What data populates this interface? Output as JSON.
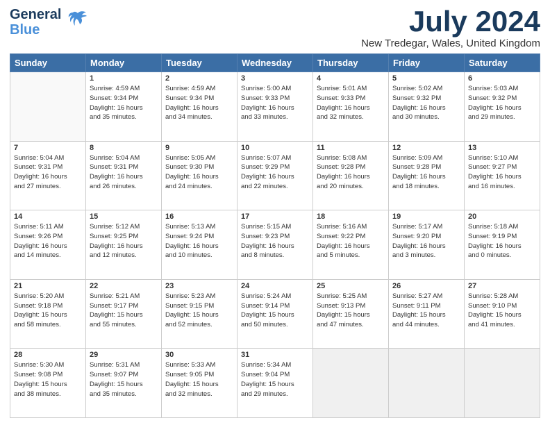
{
  "header": {
    "logo_line1": "General",
    "logo_line2": "Blue",
    "month_title": "July 2024",
    "subtitle": "New Tredegar, Wales, United Kingdom"
  },
  "days_of_week": [
    "Sunday",
    "Monday",
    "Tuesday",
    "Wednesday",
    "Thursday",
    "Friday",
    "Saturday"
  ],
  "weeks": [
    [
      {
        "day": "",
        "info": ""
      },
      {
        "day": "1",
        "info": "Sunrise: 4:59 AM\nSunset: 9:34 PM\nDaylight: 16 hours\nand 35 minutes."
      },
      {
        "day": "2",
        "info": "Sunrise: 4:59 AM\nSunset: 9:34 PM\nDaylight: 16 hours\nand 34 minutes."
      },
      {
        "day": "3",
        "info": "Sunrise: 5:00 AM\nSunset: 9:33 PM\nDaylight: 16 hours\nand 33 minutes."
      },
      {
        "day": "4",
        "info": "Sunrise: 5:01 AM\nSunset: 9:33 PM\nDaylight: 16 hours\nand 32 minutes."
      },
      {
        "day": "5",
        "info": "Sunrise: 5:02 AM\nSunset: 9:32 PM\nDaylight: 16 hours\nand 30 minutes."
      },
      {
        "day": "6",
        "info": "Sunrise: 5:03 AM\nSunset: 9:32 PM\nDaylight: 16 hours\nand 29 minutes."
      }
    ],
    [
      {
        "day": "7",
        "info": "Sunrise: 5:04 AM\nSunset: 9:31 PM\nDaylight: 16 hours\nand 27 minutes."
      },
      {
        "day": "8",
        "info": "Sunrise: 5:04 AM\nSunset: 9:31 PM\nDaylight: 16 hours\nand 26 minutes."
      },
      {
        "day": "9",
        "info": "Sunrise: 5:05 AM\nSunset: 9:30 PM\nDaylight: 16 hours\nand 24 minutes."
      },
      {
        "day": "10",
        "info": "Sunrise: 5:07 AM\nSunset: 9:29 PM\nDaylight: 16 hours\nand 22 minutes."
      },
      {
        "day": "11",
        "info": "Sunrise: 5:08 AM\nSunset: 9:28 PM\nDaylight: 16 hours\nand 20 minutes."
      },
      {
        "day": "12",
        "info": "Sunrise: 5:09 AM\nSunset: 9:28 PM\nDaylight: 16 hours\nand 18 minutes."
      },
      {
        "day": "13",
        "info": "Sunrise: 5:10 AM\nSunset: 9:27 PM\nDaylight: 16 hours\nand 16 minutes."
      }
    ],
    [
      {
        "day": "14",
        "info": "Sunrise: 5:11 AM\nSunset: 9:26 PM\nDaylight: 16 hours\nand 14 minutes."
      },
      {
        "day": "15",
        "info": "Sunrise: 5:12 AM\nSunset: 9:25 PM\nDaylight: 16 hours\nand 12 minutes."
      },
      {
        "day": "16",
        "info": "Sunrise: 5:13 AM\nSunset: 9:24 PM\nDaylight: 16 hours\nand 10 minutes."
      },
      {
        "day": "17",
        "info": "Sunrise: 5:15 AM\nSunset: 9:23 PM\nDaylight: 16 hours\nand 8 minutes."
      },
      {
        "day": "18",
        "info": "Sunrise: 5:16 AM\nSunset: 9:22 PM\nDaylight: 16 hours\nand 5 minutes."
      },
      {
        "day": "19",
        "info": "Sunrise: 5:17 AM\nSunset: 9:20 PM\nDaylight: 16 hours\nand 3 minutes."
      },
      {
        "day": "20",
        "info": "Sunrise: 5:18 AM\nSunset: 9:19 PM\nDaylight: 16 hours\nand 0 minutes."
      }
    ],
    [
      {
        "day": "21",
        "info": "Sunrise: 5:20 AM\nSunset: 9:18 PM\nDaylight: 15 hours\nand 58 minutes."
      },
      {
        "day": "22",
        "info": "Sunrise: 5:21 AM\nSunset: 9:17 PM\nDaylight: 15 hours\nand 55 minutes."
      },
      {
        "day": "23",
        "info": "Sunrise: 5:23 AM\nSunset: 9:15 PM\nDaylight: 15 hours\nand 52 minutes."
      },
      {
        "day": "24",
        "info": "Sunrise: 5:24 AM\nSunset: 9:14 PM\nDaylight: 15 hours\nand 50 minutes."
      },
      {
        "day": "25",
        "info": "Sunrise: 5:25 AM\nSunset: 9:13 PM\nDaylight: 15 hours\nand 47 minutes."
      },
      {
        "day": "26",
        "info": "Sunrise: 5:27 AM\nSunset: 9:11 PM\nDaylight: 15 hours\nand 44 minutes."
      },
      {
        "day": "27",
        "info": "Sunrise: 5:28 AM\nSunset: 9:10 PM\nDaylight: 15 hours\nand 41 minutes."
      }
    ],
    [
      {
        "day": "28",
        "info": "Sunrise: 5:30 AM\nSunset: 9:08 PM\nDaylight: 15 hours\nand 38 minutes."
      },
      {
        "day": "29",
        "info": "Sunrise: 5:31 AM\nSunset: 9:07 PM\nDaylight: 15 hours\nand 35 minutes."
      },
      {
        "day": "30",
        "info": "Sunrise: 5:33 AM\nSunset: 9:05 PM\nDaylight: 15 hours\nand 32 minutes."
      },
      {
        "day": "31",
        "info": "Sunrise: 5:34 AM\nSunset: 9:04 PM\nDaylight: 15 hours\nand 29 minutes."
      },
      {
        "day": "",
        "info": ""
      },
      {
        "day": "",
        "info": ""
      },
      {
        "day": "",
        "info": ""
      }
    ]
  ]
}
